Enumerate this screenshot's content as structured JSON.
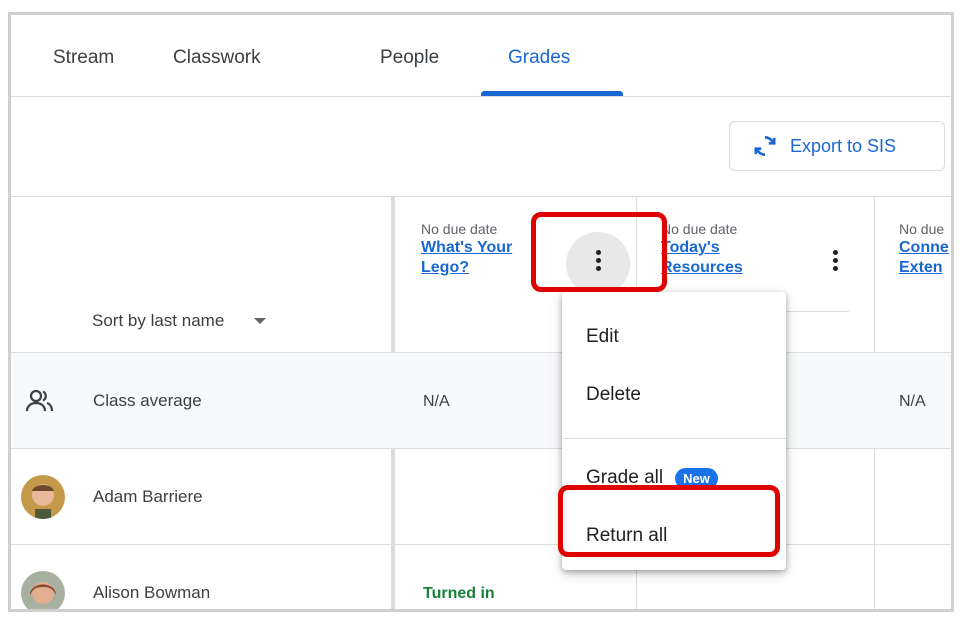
{
  "tabs": [
    {
      "label": "Stream"
    },
    {
      "label": "Classwork"
    },
    {
      "label": "People"
    },
    {
      "label": "Grades"
    }
  ],
  "active_tab": "Grades",
  "toolbar": {
    "export_label": "Export to SIS"
  },
  "sort": {
    "label": "Sort by last name"
  },
  "assignments": [
    {
      "due": "No due date",
      "title_line1": "What's Your",
      "title_line2": "Lego?"
    },
    {
      "due": "No due date",
      "title_line1": "Today's",
      "title_line2": "Resources"
    },
    {
      "due": "No due",
      "title_line1": "Conne",
      "title_line2": "Exten"
    }
  ],
  "rows": {
    "average": {
      "name": "Class average",
      "col1": "N/A",
      "col3": "N/A"
    },
    "students": [
      {
        "name": "Adam Barriere",
        "col1": ""
      },
      {
        "name": "Alison Bowman",
        "col1": "Turned in"
      }
    ]
  },
  "menu": {
    "edit": "Edit",
    "delete": "Delete",
    "grade_all": "Grade all",
    "new_badge": "New",
    "return_all": "Return all"
  },
  "colors": {
    "accent": "#1967d2",
    "highlight": "#e00000",
    "turned_in": "#188038"
  }
}
